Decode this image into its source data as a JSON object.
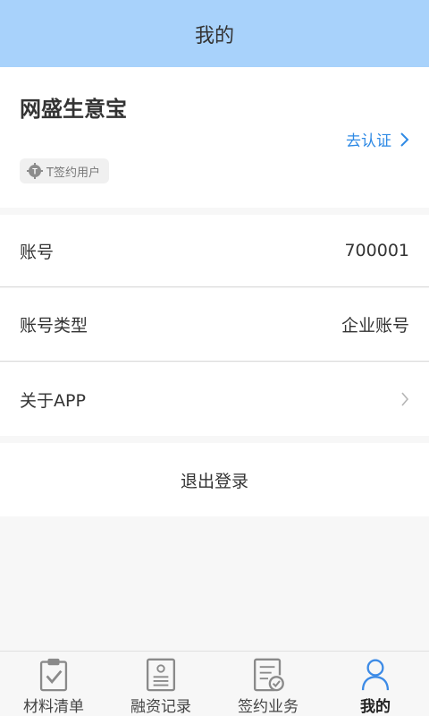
{
  "header": {
    "title": "我的"
  },
  "profile": {
    "company_name": "网盛生意宝",
    "verify_label": "去认证",
    "badge_label": "T签约用户"
  },
  "info_rows": [
    {
      "label": "账号",
      "value": "700001"
    },
    {
      "label": "账号类型",
      "value": "企业账号"
    },
    {
      "label": "关于APP",
      "value": ""
    }
  ],
  "logout_label": "退出登录",
  "tabs": [
    {
      "label": "材料清单",
      "icon": "checklist-icon",
      "active": false
    },
    {
      "label": "融资记录",
      "icon": "record-icon",
      "active": false
    },
    {
      "label": "签约业务",
      "icon": "contract-icon",
      "active": false
    },
    {
      "label": "我的",
      "icon": "user-icon",
      "active": true
    }
  ],
  "colors": {
    "header_bg": "#a8d2fb",
    "link": "#2f8ae5",
    "active_tab_icon": "#3d8be6",
    "inactive_tab_icon": "#8a8a8a"
  }
}
